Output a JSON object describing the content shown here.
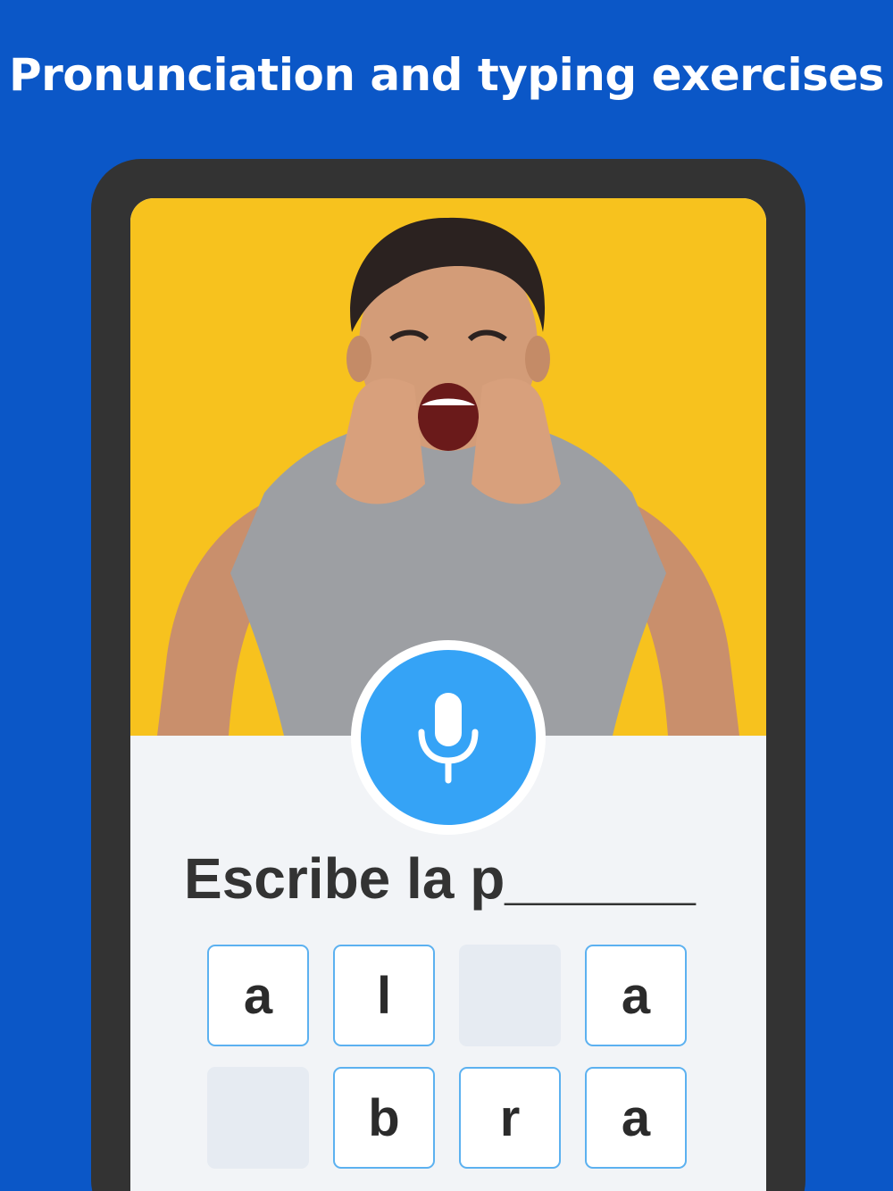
{
  "headline": "Pronunciation and typing exercises",
  "colors": {
    "background": "#0b57c7",
    "device_frame": "#333333",
    "photo_background": "#f7c21e",
    "mic_button": "#35a3f6",
    "tile_border": "#5cb1f0",
    "empty_tile": "#e6ebf2"
  },
  "exercise": {
    "prompt": "Escribe la p______",
    "mic_icon": "microphone-icon",
    "tiles_row1": [
      {
        "letter": "a",
        "state": "filled"
      },
      {
        "letter": "l",
        "state": "filled"
      },
      {
        "letter": "",
        "state": "empty"
      },
      {
        "letter": "a",
        "state": "filled"
      }
    ],
    "tiles_row2": [
      {
        "letter": "",
        "state": "empty"
      },
      {
        "letter": "b",
        "state": "filled"
      },
      {
        "letter": "r",
        "state": "filled"
      },
      {
        "letter": "a",
        "state": "filled"
      }
    ]
  }
}
